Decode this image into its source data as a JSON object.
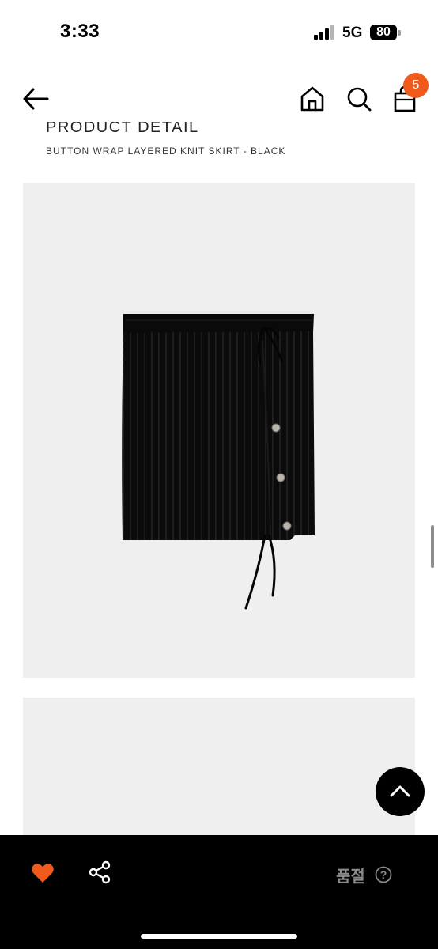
{
  "status_bar": {
    "time": "3:33",
    "network": "5G",
    "battery": "80"
  },
  "header": {
    "cart_count": "5",
    "icons": [
      "back-arrow-icon",
      "home-icon",
      "search-icon",
      "shopping-bag-icon"
    ]
  },
  "product": {
    "section_title": "PRODUCT DETAIL",
    "name": "BUTTON WRAP LAYERED KNIT SKIRT - BLACK"
  },
  "bottom_bar": {
    "status_label": "품절",
    "help_symbol": "?",
    "icons": [
      "heart-icon",
      "share-icon"
    ]
  },
  "colors": {
    "accent": "#f05a1a",
    "bottom_bar": "#000000",
    "image_bg": "#efefef",
    "disabled_text": "#8a8a8a"
  }
}
